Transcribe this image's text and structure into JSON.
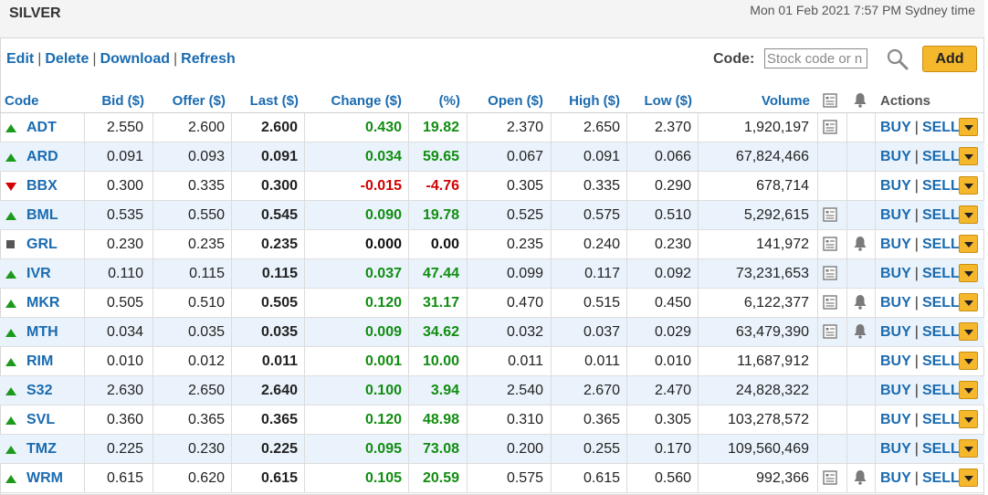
{
  "header": {
    "title": "SILVER",
    "datetime": "Mon 01 Feb 2021 7:57 PM Sydney time"
  },
  "toolbar": {
    "edit": "Edit",
    "delete": "Delete",
    "download": "Download",
    "refresh": "Refresh",
    "separator": "|",
    "code_label": "Code:",
    "code_placeholder": "Stock code or n",
    "add_label": "Add"
  },
  "columns": {
    "code": "Code",
    "bid": "Bid ($)",
    "offer": "Offer ($)",
    "last": "Last ($)",
    "change": "Change ($)",
    "pct": "(%)",
    "open": "Open ($)",
    "high": "High ($)",
    "low": "Low ($)",
    "volume": "Volume",
    "actions": "Actions"
  },
  "actions": {
    "buy": "BUY",
    "sell": "SELL",
    "separator": "|"
  },
  "colors": {
    "link": "#1a6bb0",
    "positive": "#118d11",
    "negative": "#d20000",
    "accent": "#f5b72c",
    "row_alt": "#eaf3fb"
  },
  "rows": [
    {
      "code": "ADT",
      "trend": "up",
      "bid": "2.550",
      "offer": "2.600",
      "last": "2.600",
      "change": "0.430",
      "pct": "19.82",
      "open": "2.370",
      "high": "2.650",
      "low": "2.370",
      "volume": "1,920,197",
      "announce": true,
      "alert": false
    },
    {
      "code": "ARD",
      "trend": "up",
      "bid": "0.091",
      "offer": "0.093",
      "last": "0.091",
      "change": "0.034",
      "pct": "59.65",
      "open": "0.067",
      "high": "0.091",
      "low": "0.066",
      "volume": "67,824,466",
      "announce": false,
      "alert": false
    },
    {
      "code": "BBX",
      "trend": "down",
      "bid": "0.300",
      "offer": "0.335",
      "last": "0.300",
      "change": "-0.015",
      "pct": "-4.76",
      "open": "0.305",
      "high": "0.335",
      "low": "0.290",
      "volume": "678,714",
      "announce": false,
      "alert": false
    },
    {
      "code": "BML",
      "trend": "up",
      "bid": "0.535",
      "offer": "0.550",
      "last": "0.545",
      "change": "0.090",
      "pct": "19.78",
      "open": "0.525",
      "high": "0.575",
      "low": "0.510",
      "volume": "5,292,615",
      "announce": true,
      "alert": false
    },
    {
      "code": "GRL",
      "trend": "flat",
      "bid": "0.230",
      "offer": "0.235",
      "last": "0.235",
      "change": "0.000",
      "pct": "0.00",
      "open": "0.235",
      "high": "0.240",
      "low": "0.230",
      "volume": "141,972",
      "announce": true,
      "alert": true
    },
    {
      "code": "IVR",
      "trend": "up",
      "bid": "0.110",
      "offer": "0.115",
      "last": "0.115",
      "change": "0.037",
      "pct": "47.44",
      "open": "0.099",
      "high": "0.117",
      "low": "0.092",
      "volume": "73,231,653",
      "announce": true,
      "alert": false
    },
    {
      "code": "MKR",
      "trend": "up",
      "bid": "0.505",
      "offer": "0.510",
      "last": "0.505",
      "change": "0.120",
      "pct": "31.17",
      "open": "0.470",
      "high": "0.515",
      "low": "0.450",
      "volume": "6,122,377",
      "announce": true,
      "alert": true
    },
    {
      "code": "MTH",
      "trend": "up",
      "bid": "0.034",
      "offer": "0.035",
      "last": "0.035",
      "change": "0.009",
      "pct": "34.62",
      "open": "0.032",
      "high": "0.037",
      "low": "0.029",
      "volume": "63,479,390",
      "announce": true,
      "alert": true
    },
    {
      "code": "RIM",
      "trend": "up",
      "bid": "0.010",
      "offer": "0.012",
      "last": "0.011",
      "change": "0.001",
      "pct": "10.00",
      "open": "0.011",
      "high": "0.011",
      "low": "0.010",
      "volume": "11,687,912",
      "announce": false,
      "alert": false
    },
    {
      "code": "S32",
      "trend": "up",
      "bid": "2.630",
      "offer": "2.650",
      "last": "2.640",
      "change": "0.100",
      "pct": "3.94",
      "open": "2.540",
      "high": "2.670",
      "low": "2.470",
      "volume": "24,828,322",
      "announce": false,
      "alert": false
    },
    {
      "code": "SVL",
      "trend": "up",
      "bid": "0.360",
      "offer": "0.365",
      "last": "0.365",
      "change": "0.120",
      "pct": "48.98",
      "open": "0.310",
      "high": "0.365",
      "low": "0.305",
      "volume": "103,278,572",
      "announce": false,
      "alert": false
    },
    {
      "code": "TMZ",
      "trend": "up",
      "bid": "0.225",
      "offer": "0.230",
      "last": "0.225",
      "change": "0.095",
      "pct": "73.08",
      "open": "0.200",
      "high": "0.255",
      "low": "0.170",
      "volume": "109,560,469",
      "announce": false,
      "alert": false
    },
    {
      "code": "WRM",
      "trend": "up",
      "bid": "0.615",
      "offer": "0.620",
      "last": "0.615",
      "change": "0.105",
      "pct": "20.59",
      "open": "0.575",
      "high": "0.615",
      "low": "0.560",
      "volume": "992,366",
      "announce": true,
      "alert": true
    }
  ]
}
